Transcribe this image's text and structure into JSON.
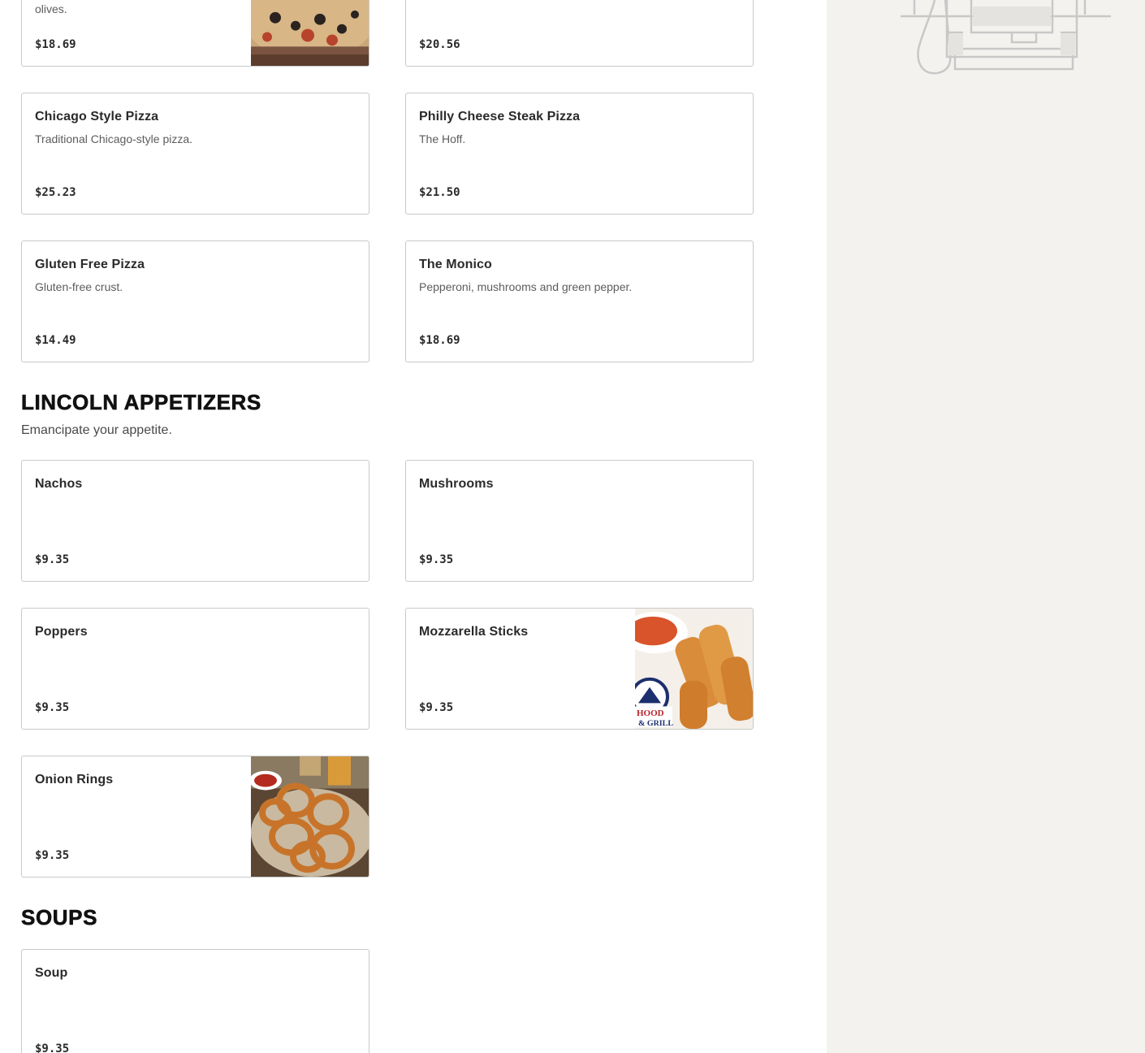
{
  "pizza": {
    "items": [
      {
        "name": "",
        "desc": "olives.",
        "price": "$18.69"
      },
      {
        "name": "",
        "desc": "",
        "price": "$20.56"
      },
      {
        "name": "Chicago Style Pizza",
        "desc": "Traditional Chicago-style pizza.",
        "price": "$25.23"
      },
      {
        "name": "Philly Cheese Steak Pizza",
        "desc": "The Hoff.",
        "price": "$21.50"
      },
      {
        "name": "Gluten Free Pizza",
        "desc": "Gluten-free crust.",
        "price": "$14.49"
      },
      {
        "name": "The Monico",
        "desc": "Pepperoni, mushrooms and green pepper.",
        "price": "$18.69"
      }
    ]
  },
  "appetizers": {
    "title": "LINCOLN APPETIZERS",
    "subtitle": "Emancipate your appetite.",
    "items": [
      {
        "name": "Nachos",
        "price": "$9.35"
      },
      {
        "name": "Mushrooms",
        "price": "$9.35"
      },
      {
        "name": "Poppers",
        "price": "$9.35"
      },
      {
        "name": "Mozzarella Sticks",
        "price": "$9.35"
      },
      {
        "name": "Onion Rings",
        "price": "$9.35"
      }
    ]
  },
  "soups": {
    "title": "SOUPS",
    "items": [
      {
        "name": "Soup",
        "price": "$9.35"
      }
    ]
  },
  "photo_logo_text": "HOOD & GRILL",
  "colors": {
    "sidebar_bg": "#f3f2ef",
    "card_border": "#c9c9c9",
    "heading": "#111111"
  }
}
